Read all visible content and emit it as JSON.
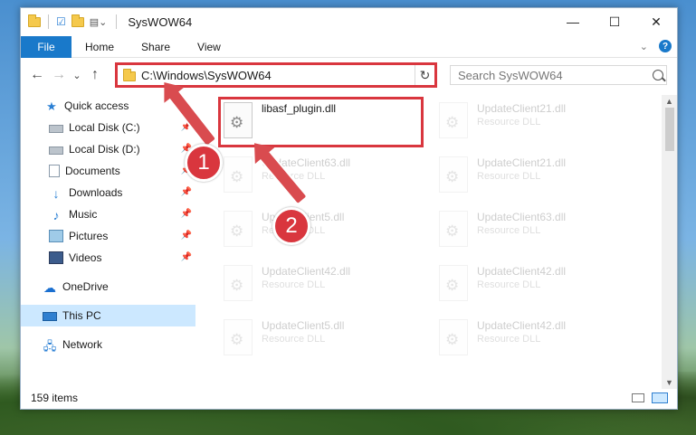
{
  "window": {
    "title": "SysWOW64",
    "controls": {
      "minimize": "—",
      "maximize": "☐",
      "close": "✕"
    }
  },
  "ribbon": {
    "tabs": [
      "File",
      "Home",
      "Share",
      "View"
    ],
    "expand_icon": "chevron-down-icon",
    "help": "?"
  },
  "navigation": {
    "back": "←",
    "forward": "→",
    "recent": "⌄",
    "up": "↑",
    "address": "C:\\Windows\\SysWOW64",
    "refresh": "↻",
    "search_placeholder": "Search SysWOW64"
  },
  "sidebar": {
    "items": [
      {
        "label": "Quick access",
        "icon": "star-icon",
        "pinned": false
      },
      {
        "label": "Local Disk (C:)",
        "icon": "drive-icon",
        "pinned": true
      },
      {
        "label": "Local Disk (D:)",
        "icon": "drive-icon",
        "pinned": true
      },
      {
        "label": "Documents",
        "icon": "document-icon",
        "pinned": true
      },
      {
        "label": "Downloads",
        "icon": "download-icon",
        "pinned": true
      },
      {
        "label": "Music",
        "icon": "music-icon",
        "pinned": true
      },
      {
        "label": "Pictures",
        "icon": "pictures-icon",
        "pinned": true
      },
      {
        "label": "Videos",
        "icon": "videos-icon",
        "pinned": true
      },
      {
        "label": "OneDrive",
        "icon": "cloud-icon",
        "pinned": false
      },
      {
        "label": "This PC",
        "icon": "computer-icon",
        "pinned": false,
        "selected": true
      },
      {
        "label": "Network",
        "icon": "network-icon",
        "pinned": false
      }
    ]
  },
  "files": [
    {
      "name": "libasf_plugin.dll",
      "type": ""
    },
    {
      "name": "UpdateClient21.dll",
      "type": "Resource DLL"
    },
    {
      "name": "UpdateClient63.dll",
      "type": "Resource DLL"
    },
    {
      "name": "UpdateClient21.dll",
      "type": "Resource DLL"
    },
    {
      "name": "UpdateClient5.dll",
      "type": "Resource DLL"
    },
    {
      "name": "UpdateClient63.dll",
      "type": "Resource DLL"
    },
    {
      "name": "UpdateClient42.dll",
      "type": "Resource DLL"
    },
    {
      "name": "UpdateClient42.dll",
      "type": "Resource DLL"
    },
    {
      "name": "UpdateClient5.dll",
      "type": "Resource DLL"
    },
    {
      "name": "UpdateClient42.dll",
      "type": "Resource DLL"
    }
  ],
  "status": {
    "item_count": "159 items"
  },
  "annotations": {
    "step1": "1",
    "step2": "2",
    "highlight_color": "#d9363e"
  }
}
